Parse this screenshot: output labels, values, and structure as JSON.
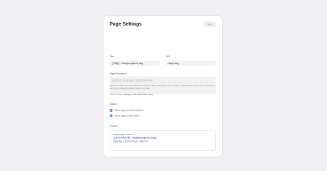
{
  "page": {
    "title": "Page Settings",
    "save_label": "Save"
  },
  "fields": {
    "title_label": "Title",
    "title_value": "{{Title}} - Hwakyeongkim's blog",
    "url_label": "URL",
    "url_value": "/blog/:slug",
    "description_label": "Page Description",
    "description_placeholder": "검색엔진이 보여줄 페이지 설명을 입력하세요.",
    "help_text": "Pass text values from the CMS can be used for title & description. For example, a field named \"Title\" can be referenced as {{Title}} to display unique content per page.",
    "cms_variables_label": "CMS Variables:",
    "cms_variables_value": "Category, Title, Description, Slug"
  },
  "search": {
    "label": "Search",
    "options": [
      {
        "label": "Show page in search engines",
        "checked": true
      },
      {
        "label": "Show page in Site Search",
        "checked": true
      }
    ]
  },
  "preview": {
    "label": "Preview",
    "url": "hwakyeongkim.framer.ai",
    "title": "실제가산에서 할 - Hwakyeongkim's blog",
    "description": "콘텐츠에는 프론트와 디자인이 실제합니다."
  },
  "colors": {
    "background": "#f0f0f2",
    "accent": "#4b8cf5",
    "link": "#1a36c8"
  }
}
